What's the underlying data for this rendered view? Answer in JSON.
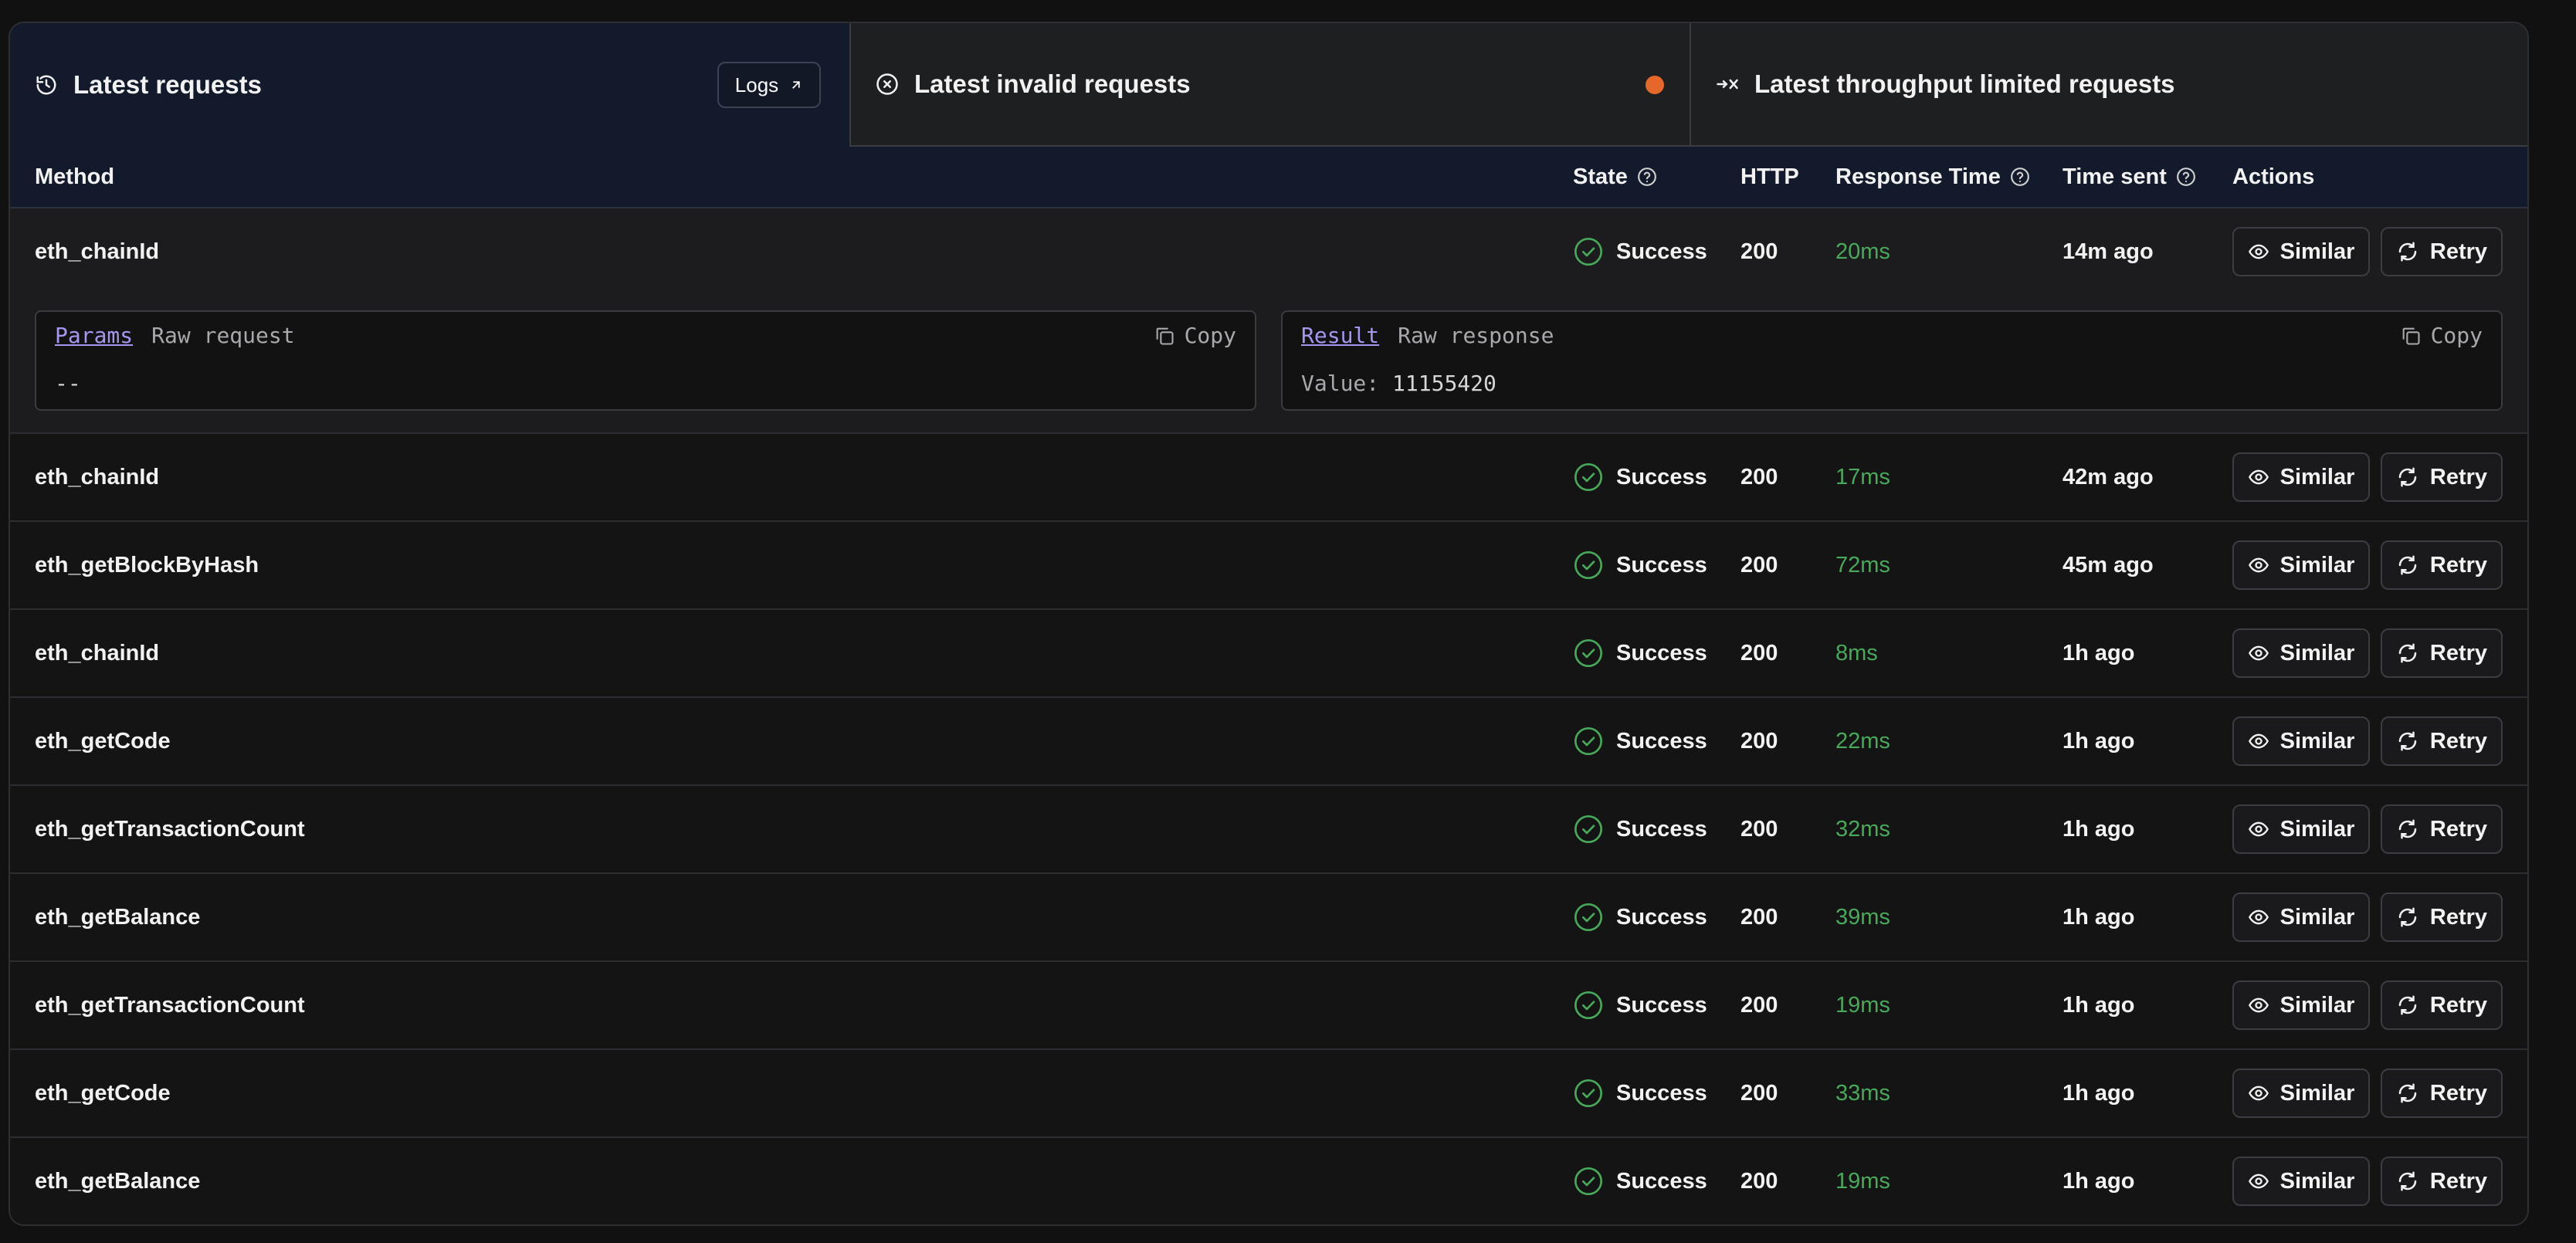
{
  "tabs": [
    {
      "label": "Latest requests",
      "icon": "history-icon",
      "active": true
    },
    {
      "label": "Latest invalid requests",
      "icon": "x-circle-icon",
      "active": false,
      "indicator_color": "#e5682a"
    },
    {
      "label": "Latest throughput limited requests",
      "icon": "throughput-limit-icon",
      "active": false
    }
  ],
  "logs_button": {
    "label": "Logs",
    "icon": "external-arrow-icon"
  },
  "table": {
    "columns": {
      "method": "Method",
      "state": "State",
      "http": "HTTP",
      "response_time": "Response Time",
      "time_sent": "Time sent",
      "actions": "Actions"
    },
    "rows": [
      {
        "method": "eth_chainId",
        "state": "Success",
        "http": "200",
        "response_time": "20ms",
        "time_sent": "14m ago",
        "expanded": true
      },
      {
        "method": "eth_chainId",
        "state": "Success",
        "http": "200",
        "response_time": "17ms",
        "time_sent": "42m ago"
      },
      {
        "method": "eth_getBlockByHash",
        "state": "Success",
        "http": "200",
        "response_time": "72ms",
        "time_sent": "45m ago"
      },
      {
        "method": "eth_chainId",
        "state": "Success",
        "http": "200",
        "response_time": "8ms",
        "time_sent": "1h ago"
      },
      {
        "method": "eth_getCode",
        "state": "Success",
        "http": "200",
        "response_time": "22ms",
        "time_sent": "1h ago"
      },
      {
        "method": "eth_getTransactionCount",
        "state": "Success",
        "http": "200",
        "response_time": "32ms",
        "time_sent": "1h ago"
      },
      {
        "method": "eth_getBalance",
        "state": "Success",
        "http": "200",
        "response_time": "39ms",
        "time_sent": "1h ago"
      },
      {
        "method": "eth_getTransactionCount",
        "state": "Success",
        "http": "200",
        "response_time": "19ms",
        "time_sent": "1h ago"
      },
      {
        "method": "eth_getCode",
        "state": "Success",
        "http": "200",
        "response_time": "33ms",
        "time_sent": "1h ago"
      },
      {
        "method": "eth_getBalance",
        "state": "Success",
        "http": "200",
        "response_time": "19ms",
        "time_sent": "1h ago"
      }
    ],
    "row_actions": {
      "similar": "Similar",
      "retry": "Retry"
    }
  },
  "request_detail": {
    "tab_active": "Params",
    "tab_other": "Raw request",
    "copy": "Copy",
    "body": "--"
  },
  "response_detail": {
    "tab_active": "Result",
    "tab_other": "Raw response",
    "copy": "Copy",
    "value_key": "Value:",
    "value": "11155420"
  },
  "colors": {
    "success": "#48a95a",
    "accent": "#a596f0",
    "indicator": "#e5682a"
  }
}
